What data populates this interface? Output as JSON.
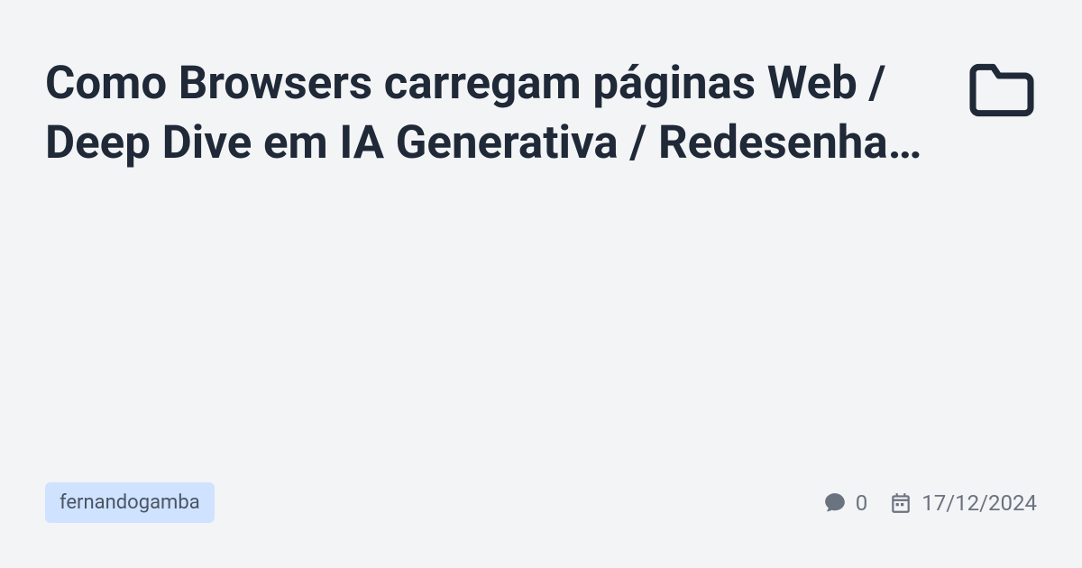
{
  "title": "Como Browsers carregam páginas Web / Deep Dive em IA Generativa / Redesenha…",
  "author": "fernandogamba",
  "comments_count": "0",
  "date": "17/12/2024"
}
